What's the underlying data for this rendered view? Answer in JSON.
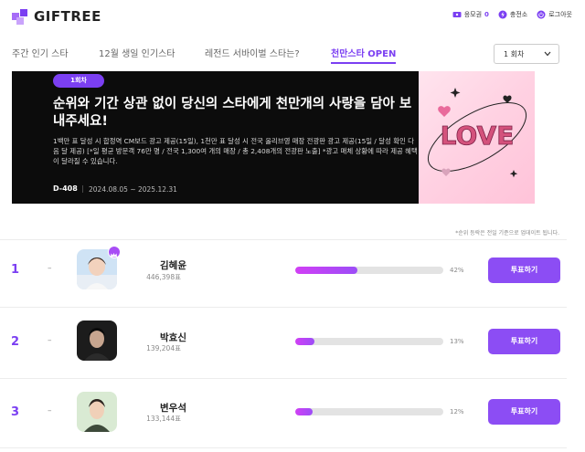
{
  "brand": {
    "name": "GIFTREE",
    "accent": "#7b3ff2"
  },
  "top_links": {
    "coupon": {
      "label": "응모권",
      "count": "0",
      "icon": "ticket-icon"
    },
    "charge": {
      "label": "충전소",
      "icon": "bolt-icon"
    },
    "logout": {
      "label": "로그아웃",
      "icon": "power-icon"
    }
  },
  "nav": {
    "tabs": [
      {
        "label": "주간 인기 스타"
      },
      {
        "label": "12월 생일 인기스타"
      },
      {
        "label": "레전드 서바이벌 스타는?"
      },
      {
        "label": "천만스타 OPEN",
        "active": true
      }
    ],
    "round_select": {
      "value": "1 회차"
    }
  },
  "banner": {
    "badge": "1회차",
    "title": "순위와 기간 상관 없이 당신의 스타에게 천만개의 사랑을 담아 보내주세요!",
    "description": "1백만 표 달성 시 합정역 CM보드 광고 제공(15일), 1천만 표 달성 시 전국 올리브영 매장 전광판 광고 제공(15일 / 달성 확인 다음 달 제공) [*일 평균 방문객 76만 명 / 전국 1,300여 개의 매장 / 총 2,408개의 전광판 노출] *광고 매체 상황에 따라 제공 혜택이 달라질 수 있습니다.",
    "dday": "D-408",
    "period": "2024.08.05 ~ 2025.12.31",
    "art_text": "LOVE"
  },
  "note": "*순위 등락은 전일 기준으로 업데이트 됩니다.",
  "ranking": {
    "vote_label": "투표하기",
    "rows": [
      {
        "rank": "1",
        "change": "–",
        "name": "김혜윤",
        "votes": "446,398표",
        "percent_label": "42%",
        "fill": 0.42
      },
      {
        "rank": "2",
        "change": "–",
        "name": "박효신",
        "votes": "139,204표",
        "percent_label": "13%",
        "fill": 0.13
      },
      {
        "rank": "3",
        "change": "–",
        "name": "변우석",
        "votes": "133,144표",
        "percent_label": "12%",
        "fill": 0.12
      }
    ]
  }
}
